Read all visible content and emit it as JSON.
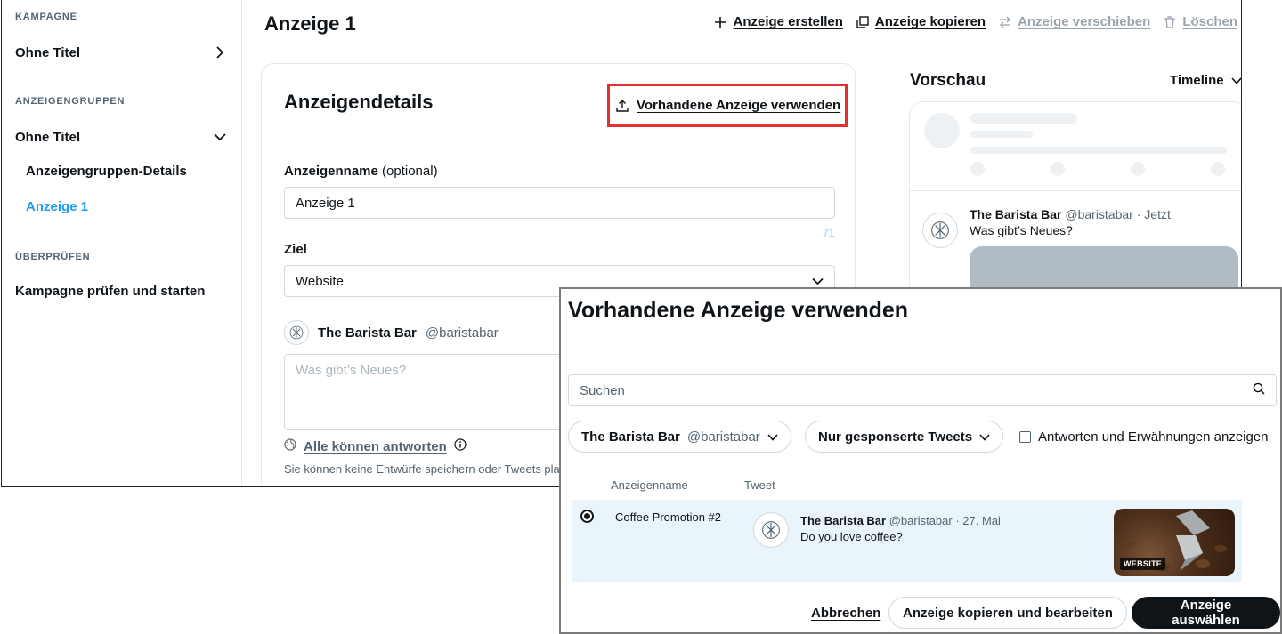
{
  "sidebar": {
    "section_campaign": "KAMPAGNE",
    "campaign_item": "Ohne Titel",
    "section_adgroups": "ANZEIGENGRUPPEN",
    "adgroup_item": "Ohne Titel",
    "adgroup_details": "Anzeigengruppen-Details",
    "ad_item": "Anzeige 1",
    "section_review": "ÜBERPRÜFEN",
    "review_item": "Kampagne prüfen und starten"
  },
  "header": {
    "title": "Anzeige 1",
    "create_label": "Anzeige erstellen",
    "copy_label": "Anzeige kopieren",
    "move_label": "Anzeige verschieben",
    "delete_label": "Löschen"
  },
  "details": {
    "title": "Anzeigendetails",
    "use_existing_label": "Vorhandene Anzeige verwenden",
    "name_label": "Anzeigenname",
    "name_optional": "(optional)",
    "name_value": "Anzeige 1",
    "name_counter": "71",
    "goal_label": "Ziel",
    "goal_value": "Website",
    "author_name": "The Barista Bar",
    "author_handle": "@baristabar",
    "compose_placeholder": "Was gibt’s Neues?",
    "reply_label": "Alle können antworten",
    "note": "Sie können keine Entwürfe speichern oder Tweets pla"
  },
  "preview": {
    "title": "Vorschau",
    "view_select": "Timeline",
    "tweet_name": "The Barista Bar",
    "tweet_meta": "@baristabar · Jetzt",
    "tweet_text": "Was gibt’s Neues?"
  },
  "modal": {
    "title": "Vorhandene Anzeige verwenden",
    "search_placeholder": "Suchen",
    "account_name": "The Barista Bar",
    "account_handle": "@baristabar",
    "tweet_filter": "Nur gesponserte Tweets",
    "replies_checkbox": "Antworten und Erwähnungen anzeigen",
    "col_name": "Anzeigenname",
    "col_tweet": "Tweet",
    "rows": [
      {
        "ad_name": "Coffee Promotion #2",
        "tweet_name": "The Barista Bar",
        "tweet_meta": "@baristabar · 27. Mai",
        "tweet_text": "Do you love coffee?",
        "badge": "WEBSITE"
      }
    ],
    "cancel_label": "Abbrechen",
    "copy_edit_label": "Anzeige kopieren und bearbeiten",
    "select_label": "Anzeige auswählen"
  },
  "colors": {
    "accent": "#1d9bf0",
    "highlight": "#e0312d",
    "primary_button": "#0f1419",
    "selected_row": "#eaf5fb"
  }
}
